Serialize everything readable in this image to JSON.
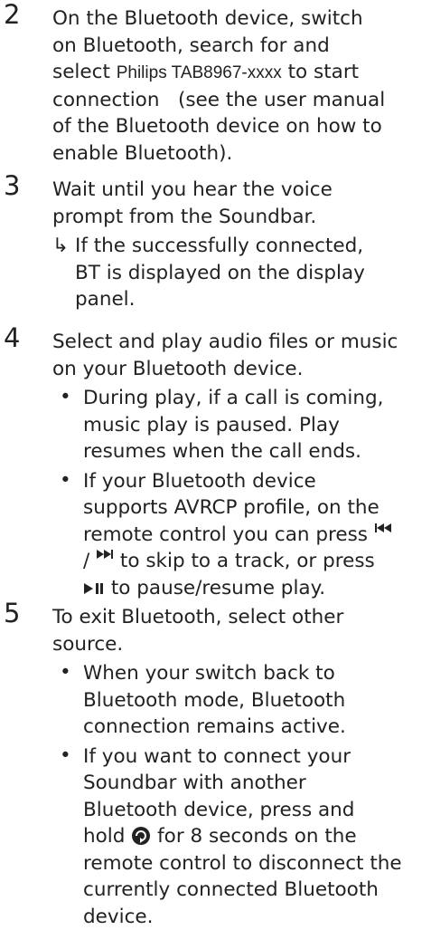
{
  "steps": [
    {
      "num": "2",
      "lines": [
        "On the Bluetooth device, switch",
        "on Bluetooth, search for and",
        [
          "select ",
          "Philips TAB8967-xxxx",
          " to start"
        ],
        "connection   (see the user manual",
        "of the Bluetooth device on how to",
        "enable Bluetooth)."
      ]
    },
    {
      "num": "3",
      "lines": [
        "Wait until you hear the voice",
        "prompt from the Soundbar."
      ],
      "result": {
        "arrow": "↳",
        "lines": [
          "If the successfully connected,",
          "BT is displayed on the display",
          "panel."
        ]
      }
    },
    {
      "num": "4",
      "lines": [
        "Select and play audio files or music",
        "on your Bluetooth device."
      ],
      "bullets": [
        [
          "During play, if a call is coming,",
          "music play is paused. Play",
          "resumes when the call ends."
        ],
        [
          "If your Bluetooth device",
          "supports AVRCP profile, on the",
          "remote control you can press",
          "/ to skip to a track, or press",
          "to pause/resume play."
        ]
      ]
    },
    {
      "num": "5",
      "lines": [
        "To exit Bluetooth, select other",
        "source."
      ],
      "bullets": [
        [
          "When your switch back to",
          "Bluetooth mode, Bluetooth",
          "connection remains active."
        ],
        [
          "If you want to connect your",
          "Soundbar with another",
          "Bluetooth device, press and",
          "hold",
          "for 8 seconds on the",
          "remote control to disconnect the",
          "currently connected Bluetooth",
          "device."
        ]
      ]
    }
  ],
  "icons": {
    "bullet": "•",
    "prev": "prev-icon",
    "next": "next-icon",
    "play_pause": "play-pause-icon",
    "pair": "pair-refresh-icon"
  }
}
